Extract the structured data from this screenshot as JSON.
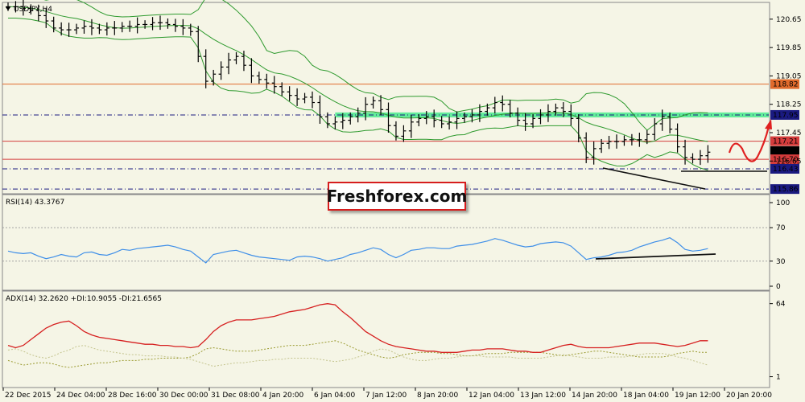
{
  "title": "USDJPY,H4",
  "rsi_label": "RSI(14) 43.3767",
  "adx_label": "ADX(14) 32.2620 +DI:10.9055 -DI:21.6565",
  "watermark": "Freshforex.com",
  "colors": {
    "background": "#f5f5e6",
    "price_bar": "#000000",
    "bollinger": "#2e9a2e",
    "resistance_line": "#e06a2c",
    "support_line": "#d43c3c",
    "dash_line": "#1a1a80",
    "zone": "#30e880",
    "rsi": "#3f8fe8",
    "adx": "#d62020",
    "plus_di": "#c4c48e",
    "minus_di": "#9a9a30",
    "forecast_arrow": "#e02020",
    "trendline": "#111111"
  },
  "chart_data": [
    {
      "type": "ohlc",
      "title": "USDJPY,H4",
      "ylim": [
        115.75,
        121.1
      ],
      "price_axis_ticks": [
        "120.65",
        "119.85",
        "119.05",
        "118.25",
        "117.45",
        "116.65"
      ],
      "x_tick_labels": [
        "22 Dec 2015",
        "24 Dec 04:00",
        "28 Dec 16:00",
        "30 Dec 00:00",
        "31 Dec 08:00",
        "4 Jan 20:00",
        "6 Jan 04:00",
        "7 Jan 12:00",
        "8 Jan 20:00",
        "12 Jan 04:00",
        "13 Jan 12:00",
        "14 Jan 20:00",
        "18 Jan 04:00",
        "19 Jan 12:00",
        "20 Jan 20:00"
      ],
      "close_series": [
        121.0,
        121.0,
        120.95,
        120.9,
        120.75,
        120.6,
        120.4,
        120.35,
        120.35,
        120.4,
        120.45,
        120.4,
        120.35,
        120.4,
        120.4,
        120.45,
        120.45,
        120.5,
        120.5,
        120.55,
        120.55,
        120.5,
        120.45,
        120.4,
        120.3,
        119.6,
        118.9,
        119.1,
        119.3,
        119.5,
        119.6,
        119.35,
        119.05,
        118.95,
        118.85,
        118.75,
        118.6,
        118.5,
        118.4,
        118.45,
        118.3,
        117.9,
        117.7,
        117.75,
        117.8,
        117.9,
        118.0,
        118.25,
        118.35,
        118.1,
        117.65,
        117.35,
        117.5,
        117.75,
        117.85,
        117.9,
        117.8,
        117.7,
        117.75,
        117.85,
        117.9,
        117.95,
        118.05,
        118.15,
        118.3,
        118.25,
        118.0,
        117.8,
        117.7,
        117.85,
        117.95,
        118.05,
        118.15,
        118.05,
        117.85,
        117.3,
        116.75,
        117.0,
        117.15,
        117.2,
        117.2,
        117.25,
        117.25,
        117.25,
        117.4,
        117.7,
        117.9,
        117.55,
        117.05,
        116.75,
        116.7,
        116.8,
        116.9
      ],
      "price_labels": [
        {
          "value": 118.82,
          "label": "118.82",
          "color": "#e06a2c",
          "line": "solid"
        },
        {
          "value": 117.95,
          "label": "117.95",
          "color": "#1a1a80",
          "line": "dashdot"
        },
        {
          "value": 117.21,
          "label": "117.21",
          "color": "#d43c3c",
          "line": "solid"
        },
        {
          "value": 116.93,
          "label": "116.93",
          "color": "#000000",
          "line": "none"
        },
        {
          "value": 116.7,
          "label": "116.70",
          "color": "#d43c3c",
          "line": "solid"
        },
        {
          "value": 116.43,
          "label": "116.43",
          "color": "#1a1a80",
          "line": "dashdot"
        },
        {
          "value": 115.86,
          "label": "115.86",
          "color": "#1a1a80",
          "line": "dashdot"
        }
      ]
    },
    {
      "type": "line",
      "title": "RSI(14) 43.3767",
      "ylim": [
        0,
        100
      ],
      "ticks": [
        "100",
        "70",
        "30",
        "0"
      ],
      "levels": [
        70,
        30
      ],
      "series": [
        {
          "values": [
            42,
            40,
            39,
            40,
            36,
            33,
            35,
            38,
            36,
            35,
            40,
            41,
            38,
            37,
            40,
            44,
            43,
            45,
            46,
            47,
            48,
            49,
            47,
            44,
            42,
            35,
            28,
            38,
            40,
            42,
            43,
            40,
            37,
            35,
            34,
            33,
            32,
            31,
            35,
            36,
            35,
            33,
            30,
            32,
            34,
            38,
            40,
            43,
            46,
            44,
            38,
            34,
            38,
            43,
            44,
            46,
            46,
            45,
            45,
            48,
            49,
            50,
            52,
            54,
            57,
            55,
            52,
            49,
            47,
            48,
            51,
            52,
            53,
            52,
            48,
            40,
            32,
            34,
            35,
            37,
            40,
            41,
            43,
            47,
            50,
            53,
            55,
            58,
            52,
            44,
            42,
            43,
            45
          ]
        }
      ]
    },
    {
      "type": "line",
      "title": "ADX(14) 32.2620 +DI:10.9055 -DI:21.6565",
      "ylim": [
        0,
        70
      ],
      "ticks": [
        "64",
        "1"
      ],
      "series": [
        {
          "values": [
            28,
            26,
            28,
            33,
            38,
            43,
            46,
            48,
            49,
            45,
            40,
            37,
            35,
            34,
            33,
            32,
            31,
            30,
            29,
            29,
            28,
            28,
            27,
            27,
            26,
            27,
            33,
            40,
            45,
            48,
            50,
            50,
            50,
            51,
            52,
            53,
            55,
            57,
            58,
            59,
            61,
            63,
            64,
            63,
            57,
            52,
            46,
            40,
            36,
            32,
            29,
            27,
            26,
            25,
            24,
            23,
            23,
            22,
            22,
            22,
            23,
            24,
            24,
            25,
            25,
            25,
            24,
            23,
            23,
            22,
            22,
            24,
            26,
            28,
            29,
            27,
            26,
            26,
            26,
            26,
            27,
            28,
            29,
            30,
            30,
            30,
            29,
            28,
            27,
            28,
            30,
            32,
            32
          ]
        },
        {
          "values": [
            24,
            25,
            23,
            20,
            18,
            17,
            19,
            22,
            24,
            27,
            28,
            26,
            24,
            23,
            22,
            21,
            20,
            20,
            19,
            19,
            19,
            18,
            18,
            17,
            16,
            14,
            12,
            10,
            11,
            12,
            13,
            13,
            14,
            15,
            15,
            16,
            16,
            17,
            17,
            17,
            17,
            16,
            15,
            14,
            15,
            16,
            18,
            20,
            23,
            25,
            24,
            21,
            18,
            16,
            15,
            15,
            16,
            17,
            17,
            18,
            19,
            19,
            19,
            18,
            18,
            18,
            18,
            17,
            17,
            17,
            17,
            18,
            19,
            20,
            19,
            18,
            17,
            17,
            17,
            18,
            18,
            18,
            19,
            20,
            21,
            21,
            21,
            20,
            18,
            17,
            15,
            13,
            11
          ]
        },
        {
          "values": [
            15,
            13,
            11,
            12,
            13,
            13,
            12,
            10,
            9,
            10,
            11,
            12,
            13,
            13,
            14,
            15,
            15,
            15,
            16,
            16,
            17,
            17,
            17,
            17,
            18,
            21,
            25,
            26,
            25,
            24,
            23,
            23,
            23,
            24,
            25,
            26,
            27,
            28,
            28,
            28,
            29,
            30,
            31,
            32,
            30,
            27,
            24,
            22,
            20,
            18,
            17,
            18,
            20,
            21,
            22,
            22,
            22,
            21,
            21,
            20,
            19,
            19,
            20,
            21,
            21,
            21,
            22,
            22,
            22,
            22,
            22,
            21,
            20,
            19,
            20,
            21,
            22,
            23,
            23,
            22,
            21,
            20,
            19,
            18,
            18,
            18,
            18,
            19,
            21,
            22,
            23,
            22,
            22
          ]
        }
      ]
    }
  ]
}
